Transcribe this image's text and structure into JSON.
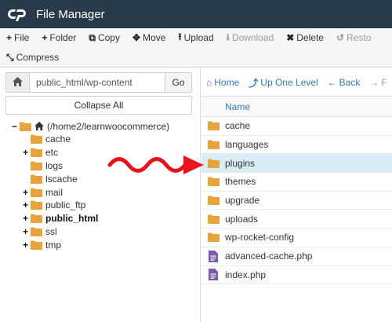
{
  "app": {
    "title": "File Manager"
  },
  "toolbar": {
    "row1": [
      {
        "icon": "plus-icon",
        "glyph": "+",
        "label": "File",
        "disabled": false
      },
      {
        "icon": "plus-icon",
        "glyph": "+",
        "label": "Folder",
        "disabled": false
      },
      {
        "icon": "copy-icon",
        "glyph": "⧉",
        "label": "Copy",
        "disabled": false
      },
      {
        "icon": "move-icon",
        "glyph": "✥",
        "label": "Move",
        "disabled": false
      },
      {
        "icon": "upload-icon",
        "glyph": "⭱",
        "label": "Upload",
        "disabled": false
      },
      {
        "icon": "download-icon",
        "glyph": "⭳",
        "label": "Download",
        "disabled": true
      },
      {
        "icon": "delete-icon",
        "glyph": "✖",
        "label": "Delete",
        "disabled": false
      },
      {
        "icon": "restore-icon",
        "glyph": "↺",
        "label": "Resto",
        "disabled": true
      }
    ],
    "row2": [
      {
        "icon": "compress-icon",
        "glyph": "⤡",
        "label": "Compress",
        "disabled": false
      }
    ]
  },
  "left": {
    "path_value": "public_html/wp-content",
    "go_label": "Go",
    "collapse_label": "Collapse All",
    "tree": [
      {
        "label": "(/home2/learnwoocommerce)",
        "toggle": "−",
        "indent": 0,
        "home": true,
        "bold": false
      },
      {
        "label": "cache",
        "toggle": "",
        "indent": 1,
        "home": false,
        "bold": false
      },
      {
        "label": "etc",
        "toggle": "+",
        "indent": 1,
        "home": false,
        "bold": false
      },
      {
        "label": "logs",
        "toggle": "",
        "indent": 1,
        "home": false,
        "bold": false
      },
      {
        "label": "lscache",
        "toggle": "",
        "indent": 1,
        "home": false,
        "bold": false
      },
      {
        "label": "mail",
        "toggle": "+",
        "indent": 1,
        "home": false,
        "bold": false
      },
      {
        "label": "public_ftp",
        "toggle": "+",
        "indent": 1,
        "home": false,
        "bold": false
      },
      {
        "label": "public_html",
        "toggle": "+",
        "indent": 1,
        "home": false,
        "bold": true
      },
      {
        "label": "ssl",
        "toggle": "+",
        "indent": 1,
        "home": false,
        "bold": false
      },
      {
        "label": "tmp",
        "toggle": "+",
        "indent": 1,
        "home": false,
        "bold": false
      }
    ]
  },
  "right": {
    "nav": [
      {
        "icon": "home-icon",
        "glyph": "⌂",
        "label": "Home",
        "dim": false
      },
      {
        "icon": "up-level-icon",
        "glyph": "⤴",
        "label": "Up One Level",
        "dim": false
      },
      {
        "icon": "back-icon",
        "glyph": "←",
        "label": "Back",
        "dim": false
      },
      {
        "icon": "forward-icon",
        "glyph": "→",
        "label": "F",
        "dim": true
      }
    ],
    "column_name": "Name",
    "rows": [
      {
        "name": "cache",
        "type": "folder",
        "selected": false
      },
      {
        "name": "languages",
        "type": "folder",
        "selected": false
      },
      {
        "name": "plugins",
        "type": "folder",
        "selected": true
      },
      {
        "name": "themes",
        "type": "folder",
        "selected": false
      },
      {
        "name": "upgrade",
        "type": "folder",
        "selected": false
      },
      {
        "name": "uploads",
        "type": "folder",
        "selected": false
      },
      {
        "name": "wp-rocket-config",
        "type": "folder",
        "selected": false
      },
      {
        "name": "advanced-cache.php",
        "type": "file",
        "selected": false
      },
      {
        "name": "index.php",
        "type": "file",
        "selected": false
      }
    ]
  },
  "colors": {
    "topbar": "#293a4a",
    "folder": "#e8a33d",
    "file": "#7b5aa6",
    "link": "#337ab7",
    "selected_row": "#d9edf7",
    "annotation_arrow": "#e8141b"
  }
}
